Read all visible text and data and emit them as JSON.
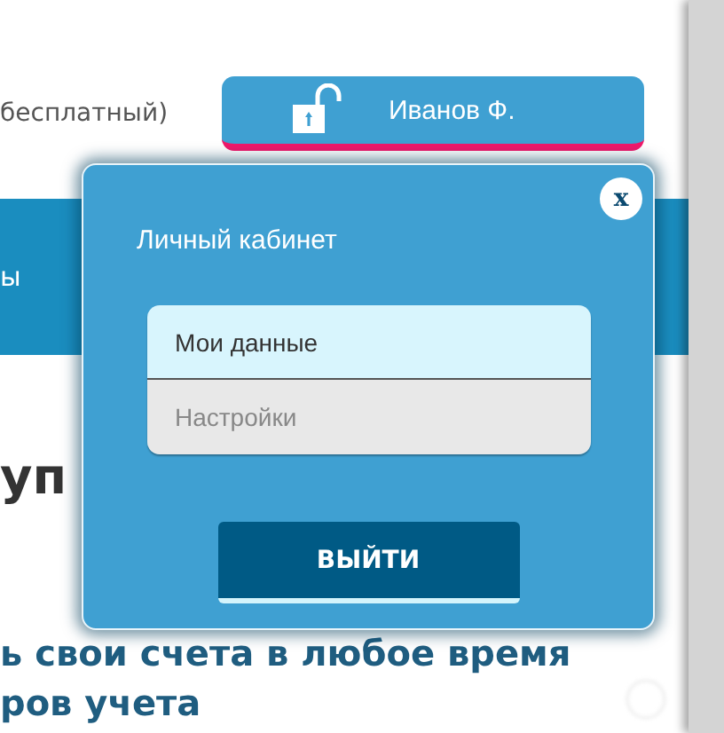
{
  "background": {
    "plan_note": "бесплатный)",
    "nav_fragment": "ы",
    "heading_fragment": "уп",
    "text_lines": [
      "ь свои счета в любое время",
      "ров учета"
    ]
  },
  "user_button": {
    "label": "Иванов Ф."
  },
  "popup": {
    "close": "x",
    "title": "Личный кабинет",
    "menu": [
      {
        "label": "Мои данные",
        "selected": true
      },
      {
        "label": "Настройки",
        "selected": false
      }
    ],
    "logout": "ВЫЙТИ"
  }
}
